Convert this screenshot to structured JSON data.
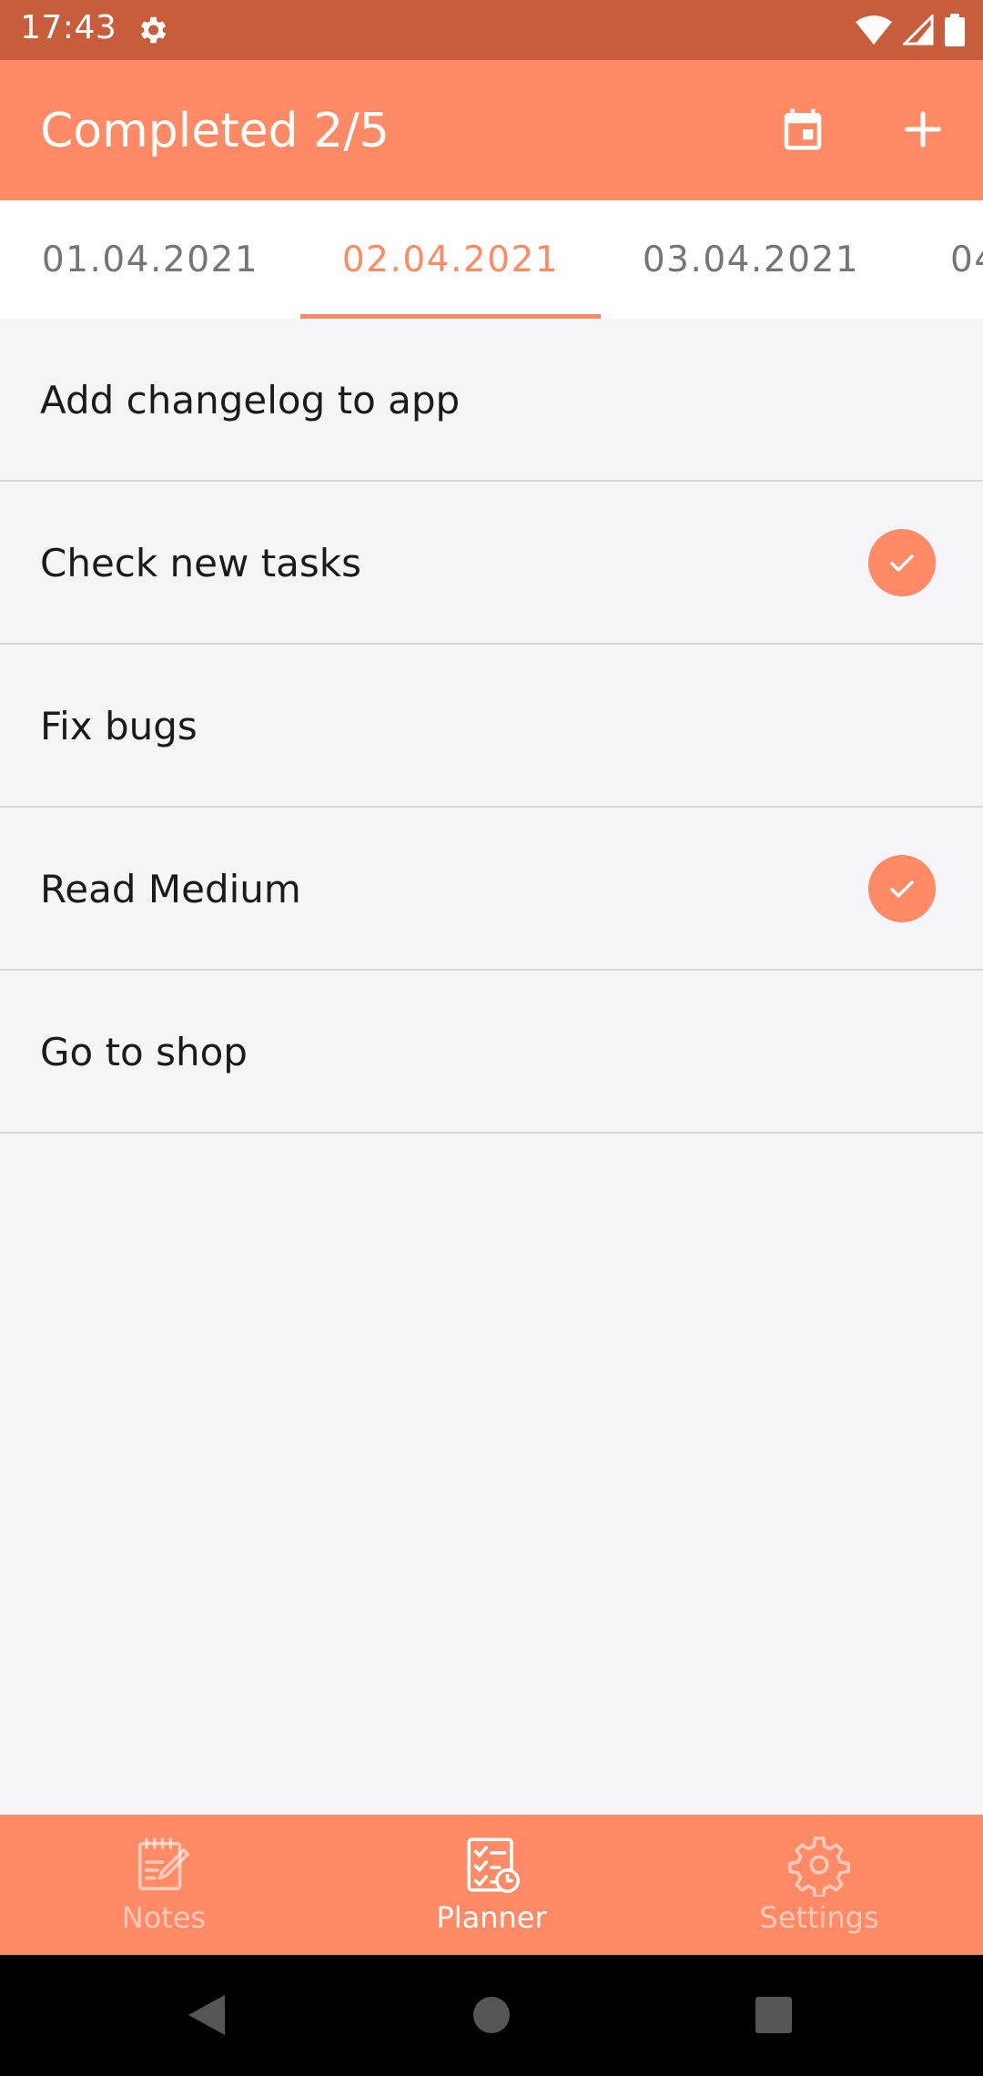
{
  "status_bar": {
    "time": "17:43",
    "icons": [
      "settings-gear-icon",
      "wifi-icon",
      "cellular-signal-icon",
      "battery-icon"
    ]
  },
  "app_bar": {
    "title": "Completed 2/5",
    "actions": [
      "calendar-icon",
      "add-icon"
    ]
  },
  "date_tabs": [
    {
      "label": "01.04.2021",
      "selected": false
    },
    {
      "label": "02.04.2021",
      "selected": true
    },
    {
      "label": "03.04.2021",
      "selected": false
    },
    {
      "label": "04",
      "selected": false
    }
  ],
  "tasks": [
    {
      "title": "Add changelog to app",
      "completed": false
    },
    {
      "title": "Check new tasks",
      "completed": true
    },
    {
      "title": "Fix bugs",
      "completed": false
    },
    {
      "title": "Read Medium",
      "completed": true
    },
    {
      "title": "Go to shop",
      "completed": false
    }
  ],
  "bottom_nav": [
    {
      "label": "Notes",
      "icon": "notes-icon",
      "active": false
    },
    {
      "label": "Planner",
      "icon": "planner-icon",
      "active": true
    },
    {
      "label": "Settings",
      "icon": "settings-icon",
      "active": false
    }
  ],
  "colors": {
    "accent": "#ff8a65",
    "status_bar": "#c75d3b",
    "background": "#f4f4f9"
  }
}
